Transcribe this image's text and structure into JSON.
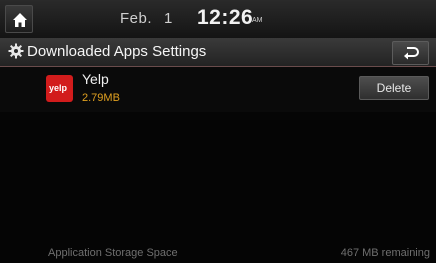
{
  "status": {
    "date": "Feb.",
    "day": "1",
    "time": "12:26",
    "ampm": "AM"
  },
  "header": {
    "title": "Downloaded Apps Settings"
  },
  "apps": [
    {
      "name": "Yelp",
      "size": "2.79MB",
      "icon_text": "yelp",
      "delete_label": "Delete"
    }
  ],
  "footer": {
    "storage_label": "Application Storage Space",
    "remaining": "467 MB remaining"
  },
  "colors": {
    "size_accent": "#e0a020",
    "yelp_red": "#d21c1c"
  },
  "icons": {
    "home": "home-icon",
    "settings": "gear-icon",
    "back": "back-arrow-icon"
  }
}
